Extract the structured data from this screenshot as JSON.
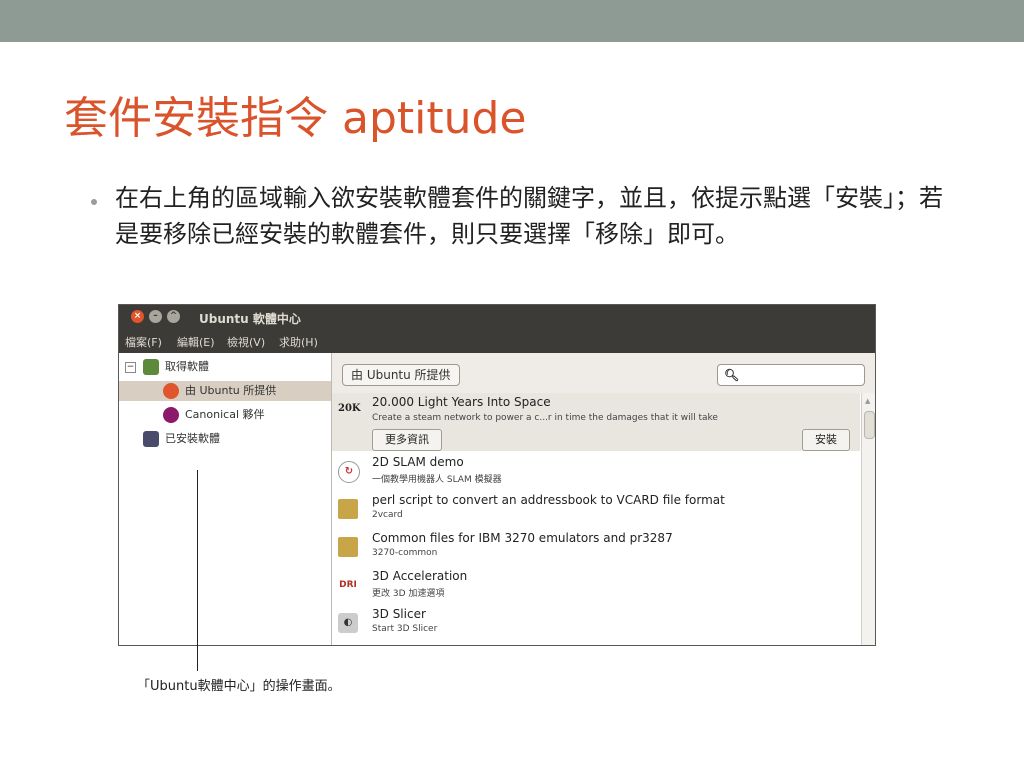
{
  "slide": {
    "title": "套件安裝指令 aptitude",
    "bullet_text": "在右上角的區域輸入欲安裝軟體套件的關鍵字，並且，依提示點選「安裝」；若是要移除已經安裝的軟體套件，則只要選擇「移除」即可。",
    "caption": "「Ubuntu軟體中心」的操作畫面。",
    "accent_color": "#d9532b",
    "topbar_color": "#8d9b94"
  },
  "window": {
    "title": "Ubuntu 軟體中心",
    "menu": [
      "檔案(F)",
      "編輯(E)",
      "檢視(V)",
      "求助(H)"
    ],
    "sidebar": {
      "items": [
        {
          "label": "取得軟體",
          "icon": "shop-icon"
        },
        {
          "label": "由 Ubuntu 所提供",
          "icon": "ubuntu-logo-icon"
        },
        {
          "label": "Canonical 夥伴",
          "icon": "canonical-logo-icon"
        },
        {
          "label": "已安裝軟體",
          "icon": "computer-icon"
        }
      ]
    },
    "breadcrumb": "由 Ubuntu 所提供",
    "search_value": "",
    "apps": [
      {
        "name": "20.000 Light Years Into Space",
        "desc": "Create a steam network to power a c...r in time the damages that it will take",
        "icon": "20k-icon",
        "icon_text": "20K"
      },
      {
        "name": "2D SLAM demo",
        "desc": "一個教學用機器人 SLAM 模擬器",
        "icon": "slam-icon",
        "icon_text": "↻"
      },
      {
        "name": "perl script to convert an addressbook to VCARD file format",
        "desc": "2vcard",
        "icon": "package-icon",
        "icon_text": ""
      },
      {
        "name": "Common files for IBM 3270 emulators and pr3287",
        "desc": "3270-common",
        "icon": "package-icon",
        "icon_text": ""
      },
      {
        "name": "3D Acceleration",
        "desc": "更改 3D 加速選項",
        "icon": "dri-icon",
        "icon_text": "DRI"
      },
      {
        "name": "3D Slicer",
        "desc": "Start 3D Slicer",
        "icon": "slicer-icon",
        "icon_text": "◐"
      }
    ],
    "more_info_label": "更多資訊",
    "install_label": "安裝"
  }
}
